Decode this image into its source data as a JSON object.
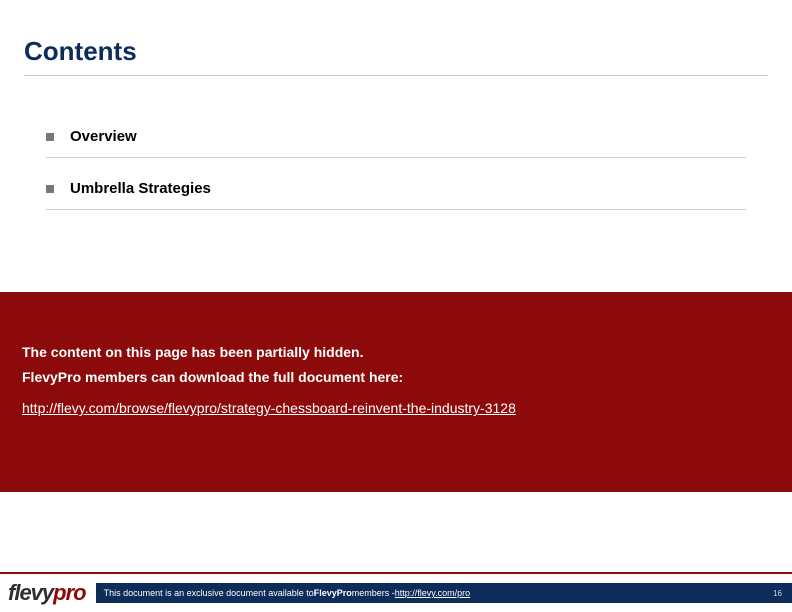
{
  "title": "Contents",
  "items": [
    {
      "label": "Overview"
    },
    {
      "label": "Umbrella Strategies"
    }
  ],
  "overlay": {
    "line1": "The content on this page has been partially hidden.",
    "line2": "FlevyPro members can download the full document here:",
    "url": "http://flevy.com/browse/flevypro/strategy-chessboard-reinvent-the-industry-3128"
  },
  "footer": {
    "logo_part1": "flevy",
    "logo_part2": "pro",
    "text_before": "This document is an exclusive document available to ",
    "text_bold": "FlevyPro",
    "text_after": " members - ",
    "link": "http://flevy.com/pro",
    "page_number": "16"
  }
}
